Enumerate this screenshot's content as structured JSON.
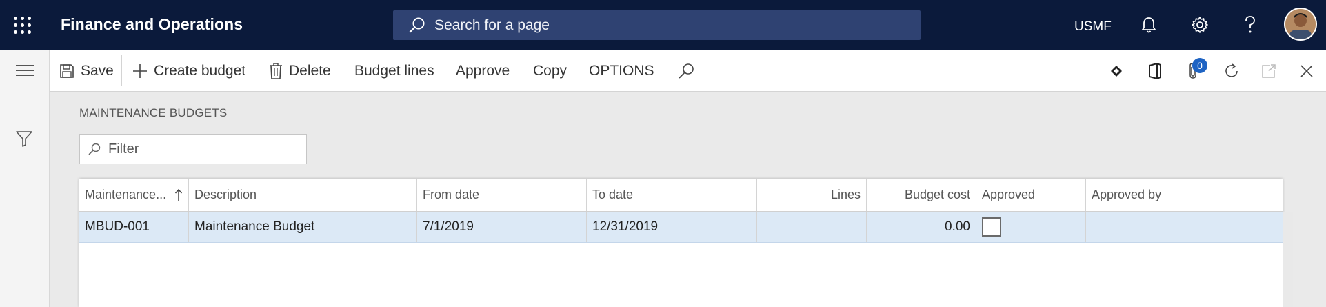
{
  "app": {
    "title": "Finance and Operations",
    "search_placeholder": "Search for a page",
    "company": "USMF"
  },
  "icons": {
    "app_launcher": "waffle-icon",
    "search": "search-icon",
    "notifications": "bell-icon",
    "settings": "gear-icon",
    "help": "help-icon"
  },
  "actions": {
    "save": "Save",
    "create_budget": "Create budget",
    "delete": "Delete",
    "budget_lines": "Budget lines",
    "approve": "Approve",
    "copy": "Copy",
    "options": "OPTIONS",
    "attachments_count": "0"
  },
  "page": {
    "title": "MAINTENANCE BUDGETS",
    "filter_placeholder": "Filter"
  },
  "grid": {
    "columns": [
      "Maintenance...",
      "Description",
      "From date",
      "To date",
      "Lines",
      "Budget cost",
      "Approved",
      "Approved by"
    ],
    "rows": [
      {
        "id": "MBUD-001",
        "description": "Maintenance Budget",
        "from_date": "7/1/2019",
        "to_date": "12/31/2019",
        "lines": "",
        "budget_cost": "0.00",
        "approved": false,
        "approved_by": ""
      }
    ]
  },
  "colors": {
    "nav_bg": "#0b1a3b",
    "search_bg": "#2f4272",
    "selected_row": "#dce9f6",
    "badge": "#1e63c3"
  }
}
